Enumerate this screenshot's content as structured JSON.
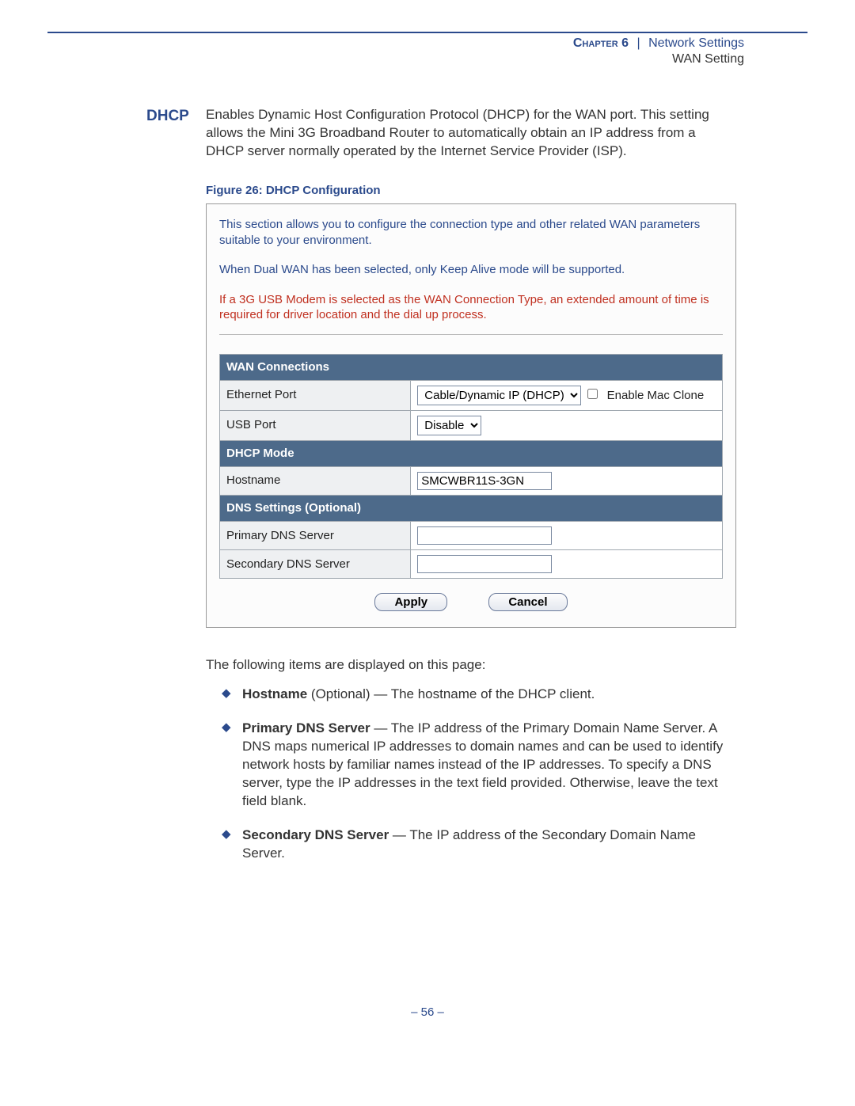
{
  "header": {
    "chapter_label": "Chapter 6",
    "divider": "|",
    "section": "Network Settings",
    "subsection": "WAN Setting"
  },
  "section": {
    "label": "DHCP",
    "text": "Enables Dynamic Host Configuration Protocol (DHCP) for the WAN port. This setting allows the Mini 3G Broadband Router to automatically obtain an IP address from a DHCP server normally operated by the Internet Service Provider (ISP)."
  },
  "figure_caption": "Figure 26:  DHCP Configuration",
  "panel": {
    "intro1": "This section allows you to configure the connection type and other related WAN parameters suitable to your environment.",
    "intro2": "When Dual WAN has been selected, only Keep Alive mode will be supported.",
    "intro_red": "If a 3G USB Modem is selected as the WAN Connection Type, an extended amount of time is required for driver location and the dial up process.",
    "sections": {
      "wan_conn_header": "WAN Connections",
      "ethernet_label": "Ethernet Port",
      "ethernet_select_value": "Cable/Dynamic IP (DHCP)",
      "enable_mac_clone": "Enable Mac Clone",
      "usb_label": "USB Port",
      "usb_select_value": "Disable",
      "dhcp_mode_header": "DHCP Mode",
      "hostname_label": "Hostname",
      "hostname_value": "SMCWBR11S-3GN",
      "dns_header": "DNS Settings (Optional)",
      "primary_dns_label": "Primary DNS Server",
      "primary_dns_value": "",
      "secondary_dns_label": "Secondary DNS Server",
      "secondary_dns_value": ""
    },
    "buttons": {
      "apply": "Apply",
      "cancel": "Cancel"
    }
  },
  "post_intro": "The following items are displayed on this page:",
  "bullets": [
    {
      "term": "Hostname",
      "rest": " (Optional) — The hostname of the DHCP client."
    },
    {
      "term": "Primary DNS Server",
      "rest": " — The IP address of the Primary Domain Name Server. A DNS maps numerical IP addresses to domain names and can be used to identify network hosts by familiar names instead of the IP addresses. To specify a DNS server, type the IP addresses in the text field provided. Otherwise, leave the text field blank."
    },
    {
      "term": "Secondary DNS Server",
      "rest": " — The IP address of the Secondary Domain Name Server."
    }
  ],
  "page_number": "–  56  –"
}
